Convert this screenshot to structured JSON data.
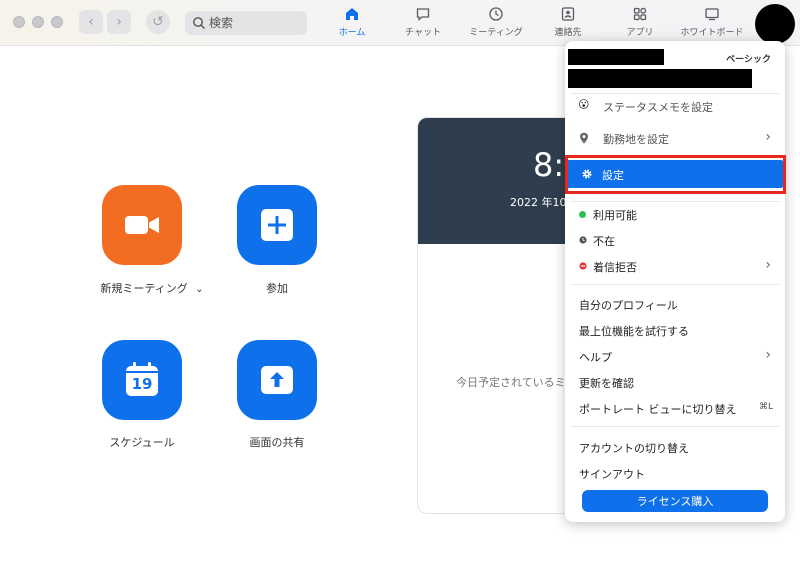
{
  "search": {
    "placeholder": "検索"
  },
  "nav": {
    "back": "‹",
    "forward": "›",
    "history": "↺"
  },
  "tabs": [
    {
      "label": "ホーム",
      "icon": "home-icon",
      "active": true
    },
    {
      "label": "チャット",
      "icon": "chat-icon"
    },
    {
      "label": "ミーティング",
      "icon": "clock-icon"
    },
    {
      "label": "連絡先",
      "icon": "contacts-icon"
    },
    {
      "label": "アプリ",
      "icon": "apps-icon"
    },
    {
      "label": "ホワイトボード",
      "icon": "whiteboard-icon"
    }
  ],
  "actions": {
    "new_meeting": "新規ミーティング",
    "new_meeting_chevron": "⌄",
    "join": "参加",
    "schedule": "スケジュール",
    "schedule_day": "19",
    "share": "画面の共有"
  },
  "calendar": {
    "time": "8:",
    "date": "2022 年10",
    "empty": "今日予定されているミ"
  },
  "menu": {
    "plan": "ベーシック",
    "status_memo": "ステータスメモを設定",
    "status_memo_icon": "😮",
    "work_location": "勤務地を設定",
    "settings": "設定",
    "available": "利用可能",
    "away": "不在",
    "dnd": "着信拒否",
    "profile": "自分のプロフィール",
    "try_features": "最上位機能を試行する",
    "help": "ヘルプ",
    "check_updates": "更新を確認",
    "portrait_view": "ポートレート ビューに切り替え",
    "portrait_shortcut": "⌘L",
    "switch_account": "アカウントの切り替え",
    "sign_out": "サインアウト",
    "buy_license": "ライセンス購入",
    "chevron": "›"
  },
  "colors": {
    "accent": "#0e71eb",
    "orange": "#f26d21",
    "available": "#2ebf4f",
    "away": "#555555",
    "dnd": "#e0333a",
    "highlight_border": "#e8281e"
  }
}
